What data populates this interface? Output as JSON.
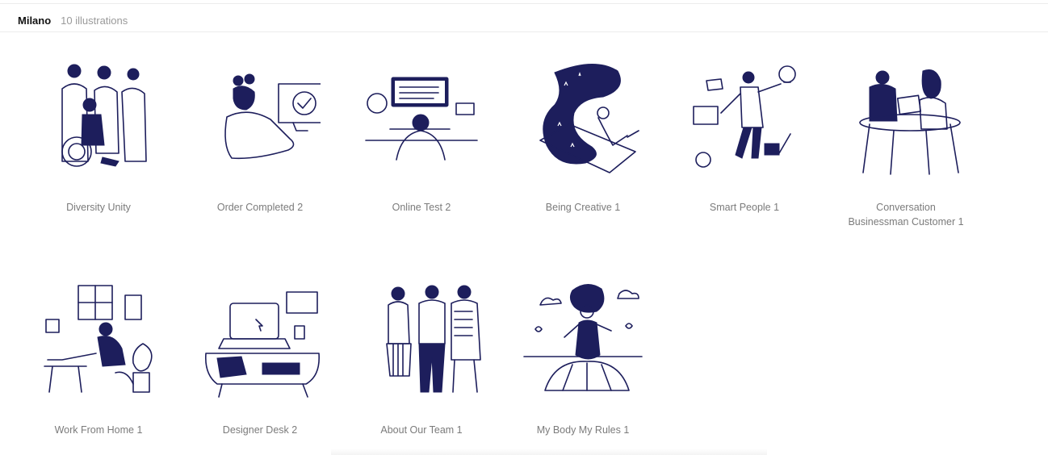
{
  "header": {
    "title": "Milano",
    "count": "10 illustrations"
  },
  "illustrations": [
    {
      "label": "Diversity Unity"
    },
    {
      "label": "Order Completed 2"
    },
    {
      "label": "Online Test 2"
    },
    {
      "label": "Being Creative 1"
    },
    {
      "label": "Smart People 1"
    },
    {
      "label": "Conversation\nBusinessman Customer 1"
    },
    {
      "label": "Work From Home 1"
    },
    {
      "label": "Designer Desk 2"
    },
    {
      "label": "About Our Team 1"
    },
    {
      "label": "My Body My Rules 1"
    }
  ],
  "colors": {
    "ink": "#1d1e5c",
    "label": "#7b7b7b",
    "divider": "#ececec"
  }
}
